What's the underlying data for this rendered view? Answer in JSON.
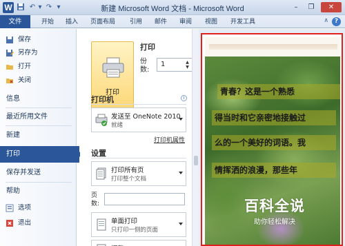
{
  "window": {
    "title": "新建 Microsoft Word 文档 - Microsoft Word",
    "app_icon_letter": "W",
    "controls": [
      "minimize-icon",
      "restore-icon",
      "close-icon"
    ]
  },
  "quick_access": [
    "save-icon",
    "undo-icon",
    "redo-icon",
    "customize-icon"
  ],
  "ribbon_tabs": [
    "文件",
    "开始",
    "插入",
    "页面布局",
    "引用",
    "邮件",
    "审阅",
    "视图",
    "开发工具"
  ],
  "sidebar": {
    "items_top": [
      {
        "label": "保存",
        "icon": "save-icon"
      },
      {
        "label": "另存为",
        "icon": "save-as-icon"
      },
      {
        "label": "打开",
        "icon": "open-folder-icon"
      },
      {
        "label": "关闭",
        "icon": "close-folder-icon"
      }
    ],
    "sections": [
      "信息",
      "最近所用文件",
      "新建",
      "打印",
      "保存并发送",
      "帮助"
    ],
    "items_bottom": [
      {
        "label": "选项",
        "icon": "options-icon"
      },
      {
        "label": "退出",
        "icon": "exit-icon"
      }
    ],
    "active": "打印"
  },
  "print": {
    "heading": "打印",
    "button_label": "打印",
    "copies_label": "份数:",
    "copies_value": "1"
  },
  "printer": {
    "heading": "打印机",
    "name": "发送至 OneNote 2010",
    "status": "就绪",
    "properties_link": "打印机属性"
  },
  "settings": {
    "heading": "设置",
    "range_main": "打印所有页",
    "range_sub": "打印整个文档",
    "pages_label": "页数:",
    "pages_value": "",
    "sides_main": "单面打印",
    "sides_sub": "只打印一侧的页面",
    "collate_main": "调整"
  },
  "preview": {
    "lines": [
      "青春？这是一个熟悉",
      "得当时和它亲密地接触过",
      "么的一个美好的词语。我",
      "情挥洒的浪漫，那些年"
    ]
  },
  "watermark": {
    "main": "百科全说",
    "sub": "助你轻松解决"
  },
  "colors": {
    "file_tab": "#2b579a",
    "highlight_frame": "#e0201c",
    "print_button": "#fcd774"
  }
}
